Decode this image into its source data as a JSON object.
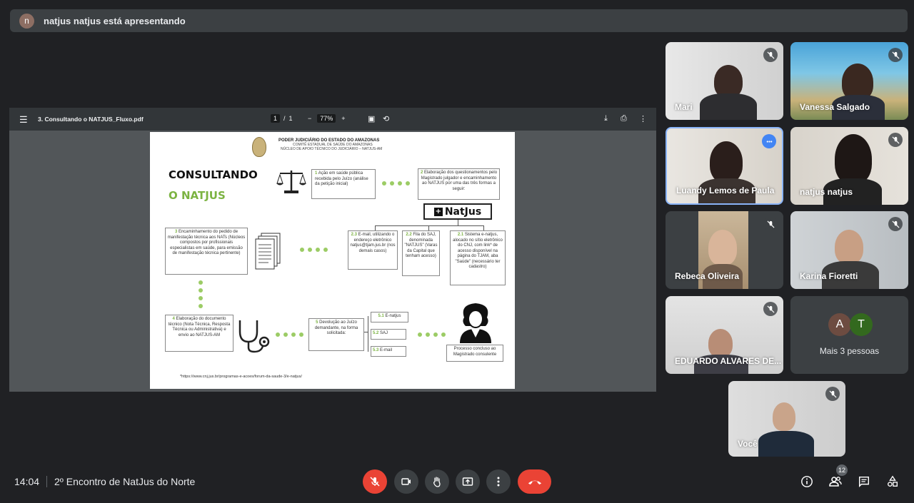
{
  "banner": {
    "avatar_letter": "n",
    "text": "natjus natjus está apresentando"
  },
  "pdf": {
    "filename": "3. Consultando o NATJUS_Fluxo.pdf",
    "page_current": "1",
    "page_sep": "/",
    "page_total": "1",
    "zoom": "77%",
    "zoom_out": "−",
    "zoom_in": "+",
    "content": {
      "header_l1": "PODER JUDICIÁRIO DO ESTADO DO AMAZONAS",
      "header_l2": "COMITÊ ESTADUAL DE SAÚDE DO AMAZONAS",
      "header_l3": "NÚCLEO DE APOIO TÉCNICO DO JUDICIÁRIO – NATJUS-AM",
      "title1": "CONSULTANDO",
      "title2": "O NATJUS",
      "box1_num": "1",
      "box1": "Ação em saúde pública recebida pelo Juízo (análise da petição inicial)",
      "box2_num": "2",
      "box2": "Elaboração dos questionamentos pelo Magistrado julgador e encaminhamento ao NATJUS por uma das três formas a seguir:",
      "natjus_logo": "NatJus",
      "box23_num": "2.3",
      "box23": "E-mail, utilizando o endereço eletrônico natjus@tjam.jus.br (nos demais casos)",
      "box22_num": "2.2",
      "box22": "Fila do SAJ, denominada \"NATJUS\" (Varas da Capital que tenham acesso)",
      "box21_num": "2.1",
      "box21": "Sistema e-natjus, alocado no sítio eletrônico do CNJ, com link* de acesso disponível na página do TJAM, aba \"Saúde\" (necessário ter cadastro)",
      "box3_num": "3",
      "box3": "Encaminhamento do pedido de manifestação técnica aos NATs (Núcleos compostos por profissionais especialistas em saúde, para emissão de manifestação técnica pertinente)",
      "box4_num": "4",
      "box4": "Elaboração do documento técnico (Nota Técnica, Resposta Técnica ou Administrativa) e envio ao NATJUS-AM",
      "box5_num": "5",
      "box5": "Devolução ao Juízo demandante, na forma solicitada:",
      "box51_num": "5.1",
      "box51": "E-natjus",
      "box52_num": "5.2",
      "box52": "SAJ",
      "box53_num": "5.3",
      "box53": "E-mail",
      "box_end": "Processo concluso ao Magistrado consulente",
      "footnote": "*https://www.cnj.jus.br/programas-e-acoes/forum-da-saude-3/e-natjus/"
    }
  },
  "participants": [
    {
      "name": "Mari",
      "muted": true
    },
    {
      "name": "Vanessa Salgado",
      "muted": true
    },
    {
      "name": "Luandy Lemos de Paula",
      "muted": false,
      "speaking": true
    },
    {
      "name": "natjus natjus",
      "muted": true
    },
    {
      "name": "Rebeca Oliveira",
      "muted": true
    },
    {
      "name": "Karina Fioretti",
      "muted": true
    },
    {
      "name": "EDUARDO ALVARES DE...",
      "muted": true
    }
  ],
  "more": {
    "avatar1": "A",
    "avatar2": "T",
    "label": "Mais 3 pessoas"
  },
  "self": {
    "name": "Você"
  },
  "bottom": {
    "time": "14:04",
    "meeting_title": "2º Encontro de NatJus do Norte",
    "people_count": "12"
  },
  "colors": {
    "end_call": "#ea4335",
    "mic_off": "#ea4335",
    "speaking_border": "#8ab4f8"
  }
}
